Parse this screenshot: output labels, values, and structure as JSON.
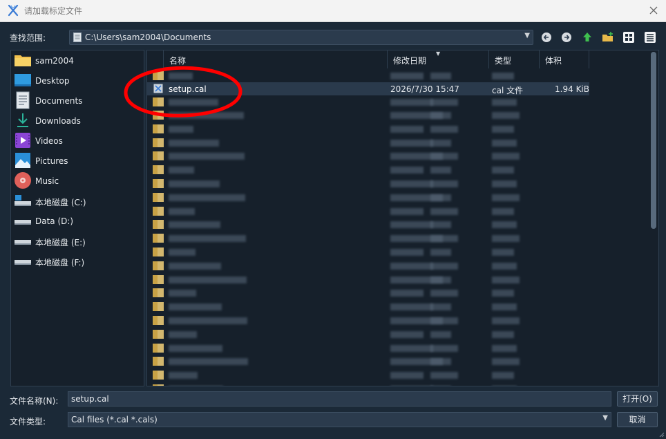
{
  "window": {
    "title": "请加载标定文件"
  },
  "toolbar": {
    "look_in_label": "查找范围:",
    "path": "C:\\Users\\sam2004\\Documents"
  },
  "places": [
    {
      "label": "sam2004",
      "icon": "folder-icon"
    },
    {
      "label": "Desktop",
      "icon": "desktop-icon"
    },
    {
      "label": "Documents",
      "icon": "documents-icon"
    },
    {
      "label": "Downloads",
      "icon": "downloads-icon"
    },
    {
      "label": "Videos",
      "icon": "videos-icon"
    },
    {
      "label": "Pictures",
      "icon": "pictures-icon"
    },
    {
      "label": "Music",
      "icon": "music-icon"
    },
    {
      "label": "本地磁盘 (C:)",
      "icon": "drive-icon"
    },
    {
      "label": "Data (D:)",
      "icon": "drive-icon"
    },
    {
      "label": "本地磁盘 (E:)",
      "icon": "drive-icon"
    },
    {
      "label": "本地磁盘 (F:)",
      "icon": "drive-icon"
    }
  ],
  "file_list": {
    "columns": {
      "name": "名称",
      "modified": "修改日期",
      "type": "类型",
      "size": "体积"
    },
    "selected_file": {
      "name": "setup.cal",
      "modified": "2026/7/30 15:47",
      "type": "cal 文件",
      "size": "1.94 KiB"
    }
  },
  "bottom": {
    "filename_label": "文件名称(N):",
    "filename_value": "setup.cal",
    "filetype_label": "文件类型:",
    "filetype_value": "Cal files (*.cal *.cals)",
    "open_button": "打开(O)",
    "cancel_button": "取消"
  },
  "colors": {
    "background": "#1b2937",
    "panel": "#16202b",
    "selection": "#2a3a4c",
    "annotation": "#ff0000",
    "folder": "#e8b94a"
  }
}
